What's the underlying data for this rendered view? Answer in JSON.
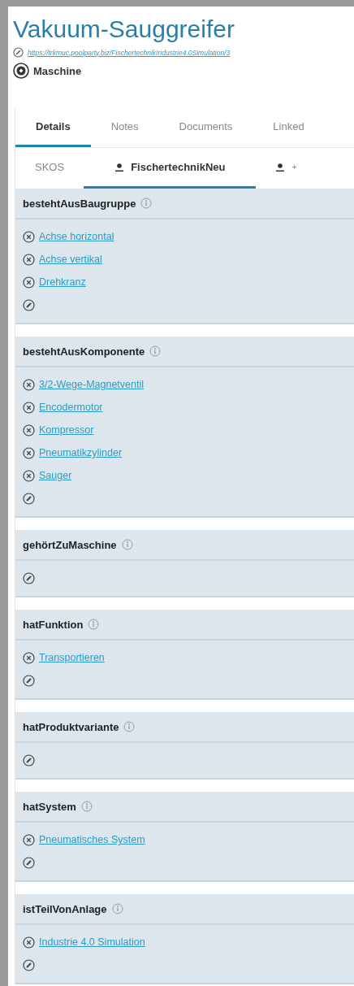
{
  "title": "Vakuum-Sauggreifer",
  "uri": "https://trkmuc.poolparty.biz/FischertechnikIndustrie4.0Simulation/3",
  "type_label": "Maschine",
  "tabs": [
    {
      "label": "Details",
      "selected": true
    },
    {
      "label": "Notes",
      "selected": false
    },
    {
      "label": "Documents",
      "selected": false
    },
    {
      "label": "Linked",
      "selected": false
    }
  ],
  "subtabs": [
    {
      "label": "SKOS",
      "person_icon": false,
      "selected": false
    },
    {
      "label": "FischertechnikNeu",
      "person_icon": true,
      "selected": true
    },
    {
      "label": "+",
      "person_icon": true,
      "selected": false
    }
  ],
  "sections": [
    {
      "name": "bestehtAusBaugruppe",
      "items": [
        "Achse horizontal",
        "Achse vertikal",
        "Drehkranz"
      ]
    },
    {
      "name": "bestehtAusKomponente",
      "items": [
        "3/2-Wege-Magnetventil",
        "Encodermotor",
        "Kompressor",
        "Pneumatikzylinder",
        "Sauger"
      ]
    },
    {
      "name": "gehörtZuMaschine"
    },
    {
      "name": "hatFunktion",
      "items": [
        "Transportieren"
      ]
    },
    {
      "name": "hatProduktvariante"
    },
    {
      "name": "hatSystem",
      "items": [
        "Pneumatisches System"
      ]
    },
    {
      "name": "istTeilVonAnlage",
      "items": [
        "Industrie 4.0 Simulation"
      ]
    }
  ]
}
